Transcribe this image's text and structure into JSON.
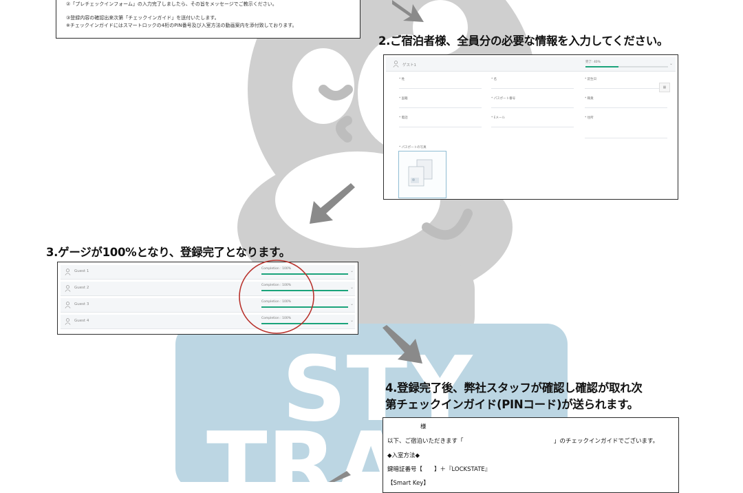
{
  "step1_box": {
    "line2": "②「プレチェックインフォーム」の入力完了しましたら、その旨をメッセージでご教示ください。",
    "line3": "③登録内容の確認出来次第「チェックインガイド」を送付いたします。",
    "line4": "※チェックインガイドにはスマートロックの4桁のPIN番号及び入室方法の動画案内を添付致しております。"
  },
  "step2": {
    "heading": "2.ご宿泊者様、全員分の必要な情報を入力してください。",
    "form": {
      "guest_label": "ゲスト1",
      "completion_label": "完了: 40%",
      "completion": 0.4,
      "row1": [
        "* 姓",
        "* 名",
        "* 誕生日"
      ],
      "row2": [
        "* 国籍",
        "* パスポート番号",
        "* 職業"
      ],
      "row3": [
        "* 電話",
        "* Eメール",
        "* 住所"
      ],
      "passport_label": "* パスポートの写真"
    }
  },
  "step3": {
    "heading": "3.ゲージが100%となり、登録完了となります。",
    "guests": [
      {
        "label": "Guest 1",
        "completion_label": "Completion : 100%",
        "completion": 1.0
      },
      {
        "label": "Guest 2",
        "completion_label": "Completion : 100%",
        "completion": 1.0
      },
      {
        "label": "Guest 3",
        "completion_label": "Completion : 100%",
        "completion": 1.0
      },
      {
        "label": "Guest 4",
        "completion_label": "Completion : 100%",
        "completion": 1.0
      }
    ]
  },
  "step4": {
    "heading_line1": "4.登録完了後、弊社スタッフが確認し確認が取れ次",
    "heading_line2": "第チェックインガイド(PINコード)が送られます。",
    "mail": {
      "salutation": "様",
      "intro_before": "以下、ご宿泊いただきます「",
      "intro_after": "」のチェックインガイドでございます。",
      "section": "◆入室方法◆",
      "key_line": "鍵暗証番号【　　】＋『LOCKSTATE』",
      "smart_key": "【Smart Key】"
    }
  },
  "colors": {
    "progress": "#1aa37a",
    "highlight_circle": "#b8322c",
    "arrow": "#8a8a8a",
    "watermark": "#c9c9c9",
    "watermark_blue": "#bcd6e3"
  }
}
